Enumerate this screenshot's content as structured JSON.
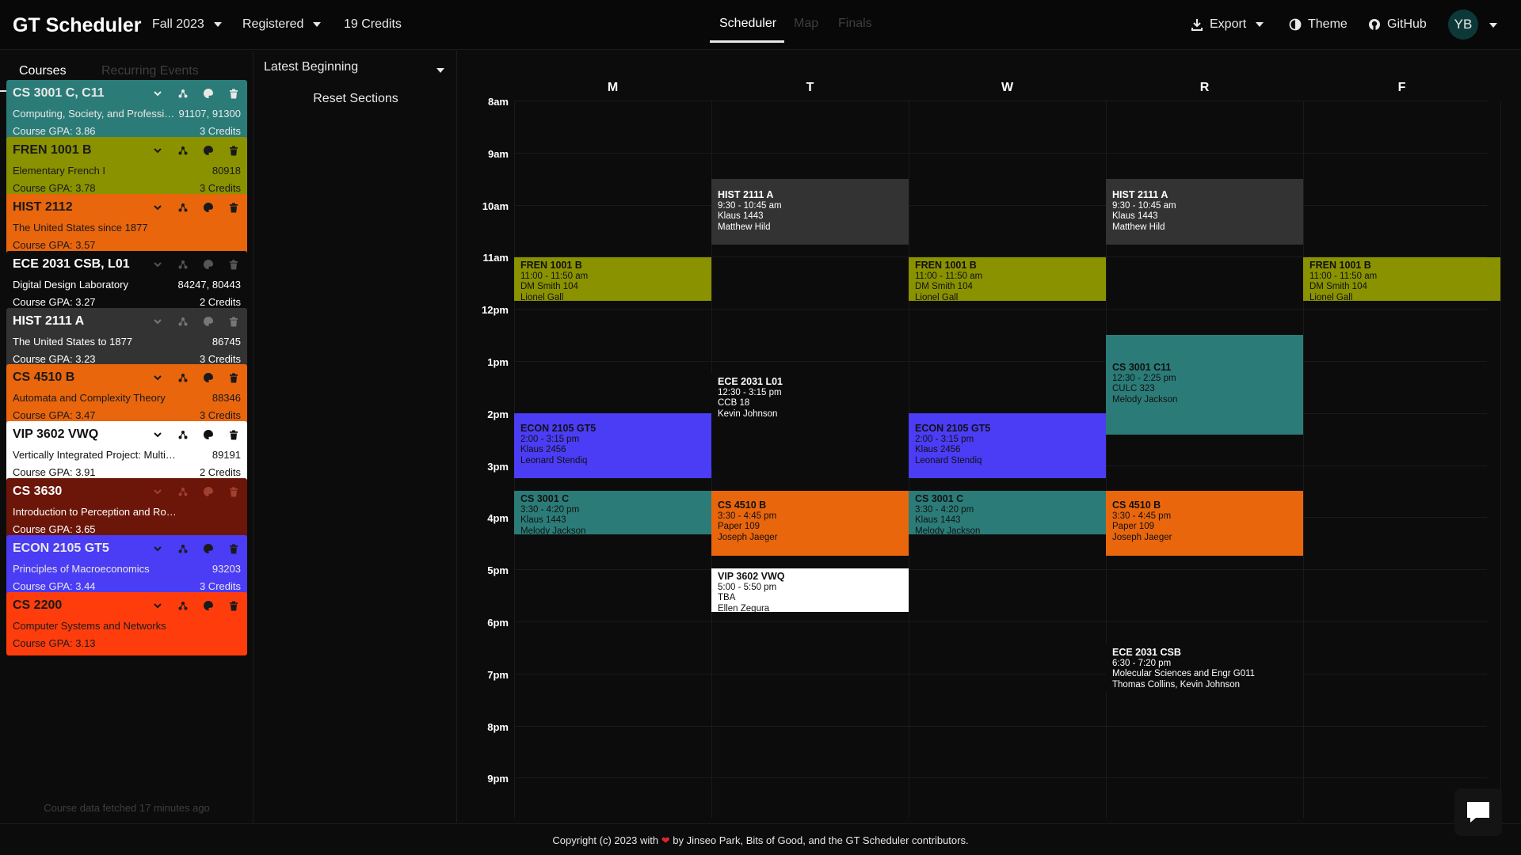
{
  "header": {
    "app_title": "GT Scheduler",
    "term": "Fall 2023",
    "version": "Registered",
    "credits": "19 Credits",
    "tabs": [
      {
        "label": "Scheduler",
        "active": true
      },
      {
        "label": "Map",
        "active": false
      },
      {
        "label": "Finals",
        "active": false
      }
    ],
    "export_label": "Export",
    "theme_label": "Theme",
    "github_label": "GitHub",
    "avatar_initials": "YB"
  },
  "sidebar": {
    "tabs": [
      {
        "label": "Courses",
        "active": true
      },
      {
        "label": "Recurring Events",
        "active": false
      }
    ],
    "courses": [
      {
        "code": "CS 3001 C, C11",
        "title": "Computing, Society, and Professionalism",
        "crn": "91107, 91300",
        "gpa": "Course GPA: 3.86",
        "credits": "3 Credits",
        "color": "#2b7c78",
        "text_color": "#e8e8e8",
        "icon_color": "#e8e8e8"
      },
      {
        "code": "FREN 1001 B",
        "title": "Elementary French I",
        "crn": "80918",
        "gpa": "Course GPA: 3.78",
        "credits": "3 Credits",
        "color": "#8a9200",
        "text_color": "#1a1a1a",
        "icon_color": "#1a1a1a"
      },
      {
        "code": "HIST 2112",
        "title": "The United States since 1877",
        "crn": "",
        "gpa": "Course GPA: 3.57",
        "credits": "",
        "color": "#e9660d",
        "text_color": "#1a1a1a",
        "icon_color": "#1a1a1a"
      },
      {
        "code": "ECE 2031 CSB, L01",
        "title": "Digital Design Laboratory",
        "crn": "84247, 80443",
        "gpa": "Course GPA: 3.27",
        "credits": "2 Credits",
        "color": "#0c0c0c",
        "text_color": "#ffffff",
        "icon_color": "#555555"
      },
      {
        "code": "HIST 2111 A",
        "title": "The United States to 1877",
        "crn": "86745",
        "gpa": "Course GPA: 3.23",
        "credits": "3 Credits",
        "color": "#333333",
        "text_color": "#ffffff",
        "icon_color": "#777777"
      },
      {
        "code": "CS 4510 B",
        "title": "Automata and Complexity Theory",
        "crn": "88346",
        "gpa": "Course GPA: 3.47",
        "credits": "3 Credits",
        "color": "#e9660d",
        "text_color": "#1a1a1a",
        "icon_color": "#1a1a1a"
      },
      {
        "code": "VIP 3602 VWQ",
        "title": "Vertically Integrated Project: Multidisciplinary",
        "crn": "89191",
        "gpa": "Course GPA: 3.91",
        "credits": "2 Credits",
        "color": "#ffffff",
        "text_color": "#111111",
        "icon_color": "#111111"
      },
      {
        "code": "CS 3630",
        "title": "Introduction to Perception and Robotics",
        "crn": "",
        "gpa": "Course GPA: 3.65",
        "credits": "",
        "color": "#6b1608",
        "text_color": "#ffffff",
        "icon_color": "#a04030"
      },
      {
        "code": "ECON 2105 GT5",
        "title": "Principles of Macroeconomics",
        "crn": "93203",
        "gpa": "Course GPA: 3.44",
        "credits": "3 Credits",
        "color": "#4b3cf5",
        "text_color": "#e8e8e8",
        "icon_color": "#1a1a1a"
      },
      {
        "code": "CS 2200",
        "title": "Computer Systems and Networks",
        "crn": "",
        "gpa": "Course GPA: 3.13",
        "credits": "",
        "color": "#ff3d0c",
        "text_color": "#1a1a1a",
        "icon_color": "#1a1a1a"
      }
    ],
    "fetched": "Course data fetched 17 minutes ago"
  },
  "options": {
    "sort_label": "Latest Beginning",
    "reset_label": "Reset Sections"
  },
  "calendar": {
    "days": [
      "M",
      "T",
      "W",
      "R",
      "F"
    ],
    "hours": [
      "8am",
      "9am",
      "10am",
      "11am",
      "12pm",
      "1pm",
      "2pm",
      "3pm",
      "4pm",
      "5pm",
      "6pm",
      "7pm",
      "8pm",
      "9pm"
    ],
    "events": [
      {
        "id": "hist-t",
        "code": "HIST 2111 A",
        "time": "9:30 - 10:45 am",
        "loc": "Klaus 1443",
        "instr": "Matthew Hild",
        "color": "#333333",
        "text": "#ffffff"
      },
      {
        "id": "hist-r",
        "code": "HIST 2111 A",
        "time": "9:30 - 10:45 am",
        "loc": "Klaus 1443",
        "instr": "Matthew Hild",
        "color": "#333333",
        "text": "#ffffff"
      },
      {
        "id": "fren-m",
        "code": "FREN 1001 B",
        "time": "11:00 - 11:50 am",
        "loc": "DM Smith 104",
        "instr": "Lionel Gall",
        "color": "#8a9200",
        "text": "#111111"
      },
      {
        "id": "fren-w",
        "code": "FREN 1001 B",
        "time": "11:00 - 11:50 am",
        "loc": "DM Smith 104",
        "instr": "Lionel Gall",
        "color": "#8a9200",
        "text": "#111111"
      },
      {
        "id": "fren-f",
        "code": "FREN 1001 B",
        "time": "11:00 - 11:50 am",
        "loc": "DM Smith 104",
        "instr": "Lionel Gall",
        "color": "#8a9200",
        "text": "#111111"
      },
      {
        "id": "cs-c11",
        "code": "CS 3001 C11",
        "time": "12:30 - 2:25 pm",
        "loc": "CULC 323",
        "instr": "Melody Jackson",
        "color": "#2b7c78",
        "text": "#111111"
      },
      {
        "id": "ece-l01",
        "code": "ECE 2031 L01",
        "time": "12:30 - 3:15 pm",
        "loc": "CCB 18",
        "instr": "Kevin Johnson",
        "color": "#0c0c0c",
        "text": "#ffffff"
      },
      {
        "id": "econ-m",
        "code": "ECON 2105 GT5",
        "time": "2:00 - 3:15 pm",
        "loc": "Klaus 2456",
        "instr": "Leonard Stendiq",
        "color": "#4b3cf5",
        "text": "#111111"
      },
      {
        "id": "econ-w",
        "code": "ECON 2105 GT5",
        "time": "2:00 - 3:15 pm",
        "loc": "Klaus 2456",
        "instr": "Leonard Stendiq",
        "color": "#4b3cf5",
        "text": "#111111"
      },
      {
        "id": "cs3001-m",
        "code": "CS 3001 C",
        "time": "3:30 - 4:20 pm",
        "loc": "Klaus 1443",
        "instr": "Melody Jackson",
        "color": "#2b7c78",
        "text": "#111111"
      },
      {
        "id": "cs3001-w",
        "code": "CS 3001 C",
        "time": "3:30 - 4:20 pm",
        "loc": "Klaus 1443",
        "instr": "Melody Jackson",
        "color": "#2b7c78",
        "text": "#111111"
      },
      {
        "id": "cs4510-t",
        "code": "CS 4510 B",
        "time": "3:30 - 4:45 pm",
        "loc": "Paper 109",
        "instr": "Joseph Jaeger",
        "color": "#e9660d",
        "text": "#111111"
      },
      {
        "id": "cs4510-r",
        "code": "CS 4510 B",
        "time": "3:30 - 4:45 pm",
        "loc": "Paper 109",
        "instr": "Joseph Jaeger",
        "color": "#e9660d",
        "text": "#111111"
      },
      {
        "id": "vip-t",
        "code": "VIP 3602 VWQ",
        "time": "5:00 - 5:50 pm",
        "loc": "TBA",
        "instr": "Ellen Zegura",
        "color": "#ffffff",
        "text": "#111111"
      },
      {
        "id": "ece-csb",
        "code": "ECE 2031 CSB",
        "time": "6:30 - 7:20 pm",
        "loc": "Molecular Sciences and Engr G011",
        "instr": "Thomas Collins, Kevin Johnson",
        "color": "#0c0c0c",
        "text": "#ffffff"
      }
    ]
  },
  "footer": {
    "prefix": "Copyright (c) 2023 with",
    "heart": "❤",
    "suffix": "by Jinseo Park, Bits of Good, and the GT Scheduler contributors."
  }
}
